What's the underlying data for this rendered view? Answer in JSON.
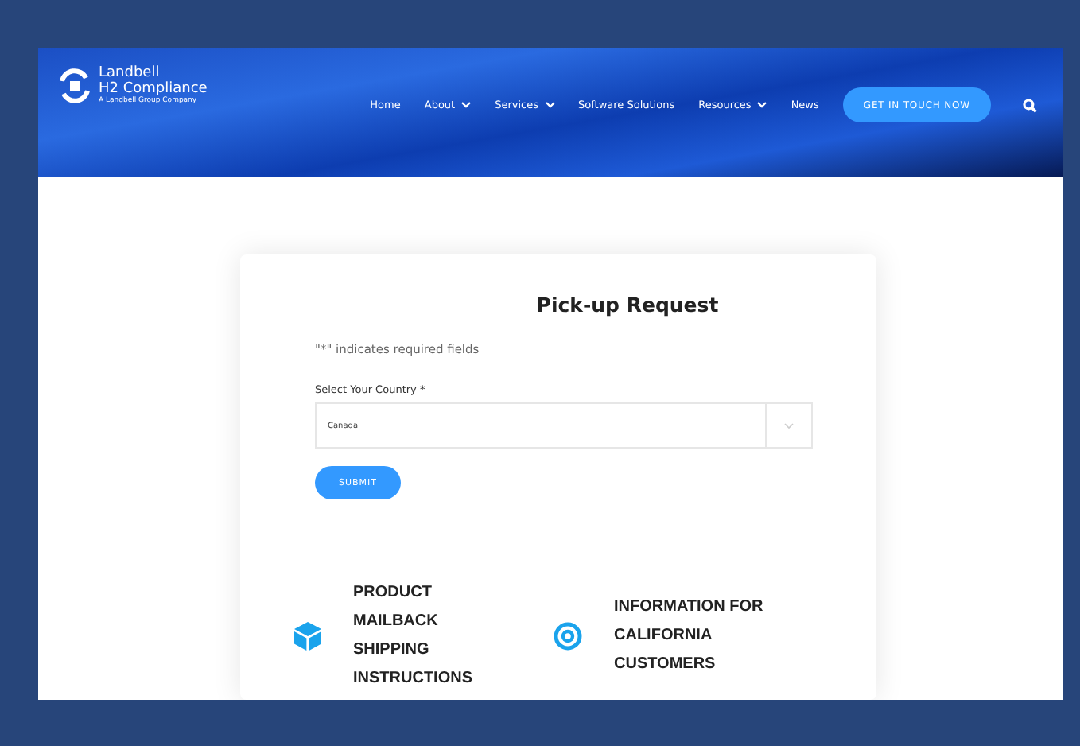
{
  "brand": {
    "name_line1": "Landbell",
    "name_line2": "H2 Compliance",
    "tagline": "A Landbell Group Company"
  },
  "nav": [
    {
      "label": "Home",
      "dropdown": false
    },
    {
      "label": "About",
      "dropdown": true
    },
    {
      "label": "Services",
      "dropdown": true
    },
    {
      "label": "Software Solutions",
      "dropdown": false
    },
    {
      "label": "Resources",
      "dropdown": true
    },
    {
      "label": "News",
      "dropdown": false
    }
  ],
  "cta": "GET IN TOUCH NOW",
  "form": {
    "title": "Pick-up Request",
    "required_note": "\"*\" indicates required fields",
    "country_label": "Select Your Country *",
    "country_value": "Canada",
    "submit": "SUBMIT"
  },
  "features": [
    {
      "kind": "box",
      "title": "PRODUCT MAILBACK SHIPPING INSTRUCTIONS"
    },
    {
      "kind": "target",
      "title": "INFORMATION FOR CALIFORNIA CUSTOMERS"
    }
  ]
}
